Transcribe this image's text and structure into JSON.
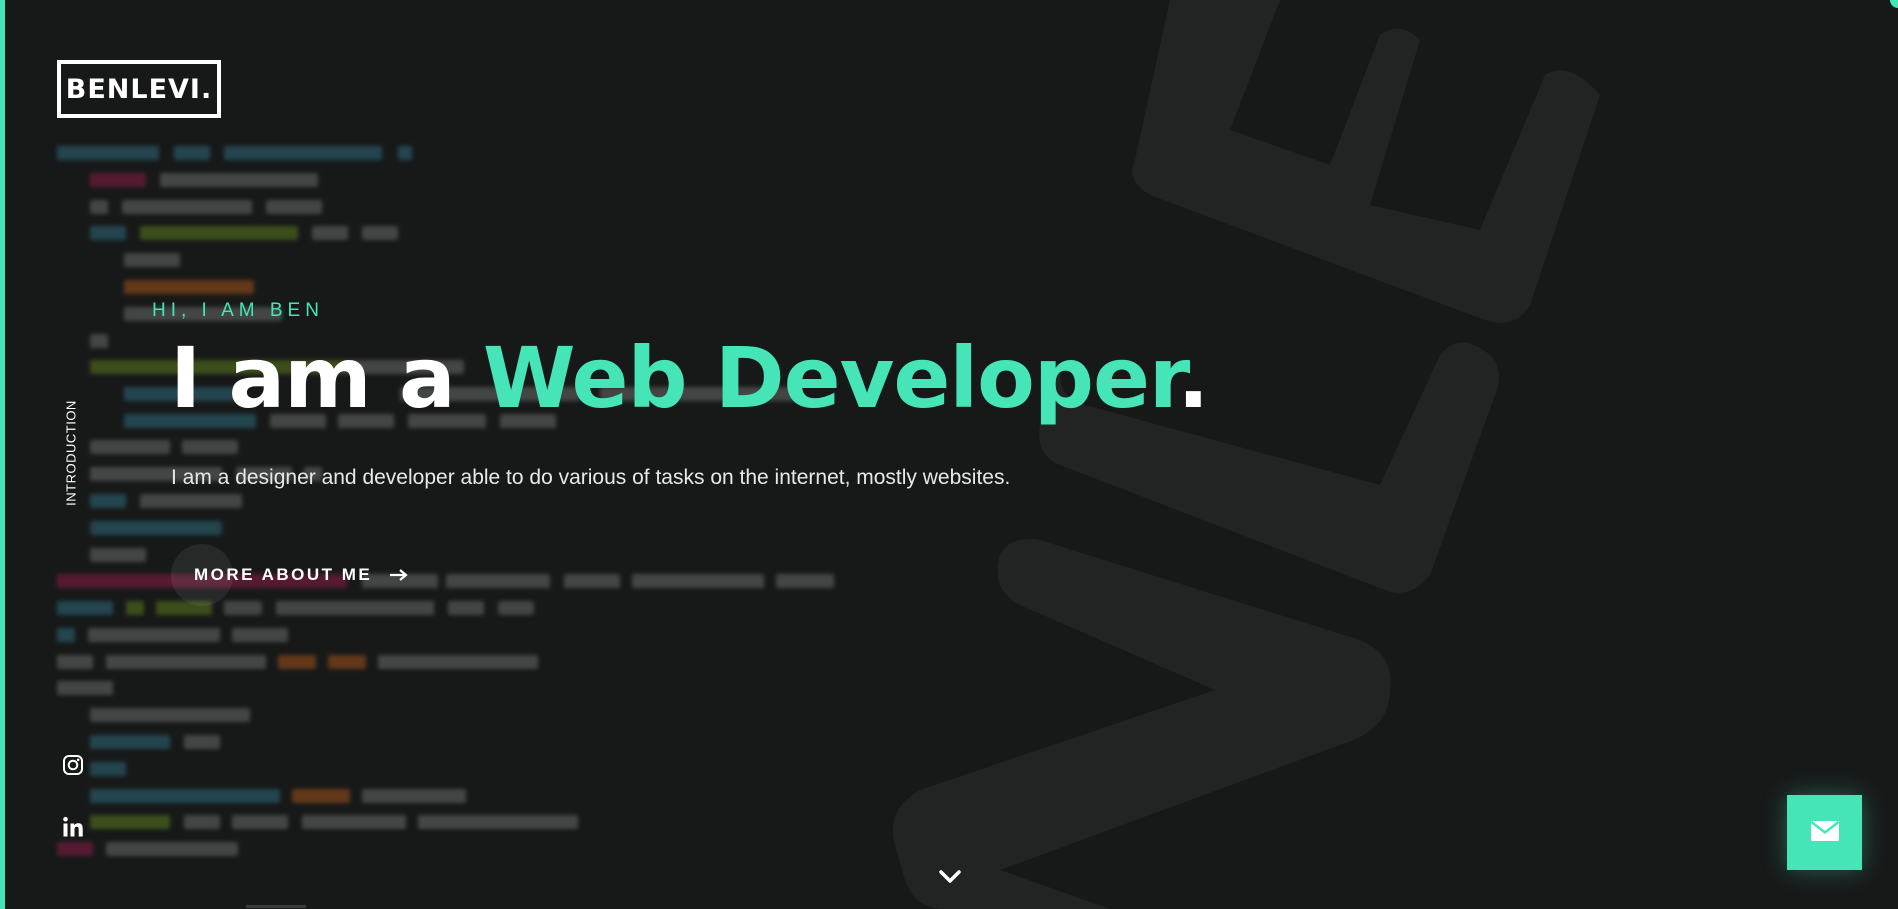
{
  "colors": {
    "background": "#171919",
    "accent": "#46e5b8",
    "text": "#ffffff"
  },
  "brand": {
    "logo_text": "BENLEVI."
  },
  "side_label": "INTRODUCTION",
  "hero": {
    "greeting": "HI, I AM BEN",
    "headline_prefix": "I am a ",
    "headline_accent": "Web Developer",
    "headline_suffix": ".",
    "subtitle": "I am a designer and developer able to do various of tasks on the internet, mostly websites.",
    "cta_label": "MORE ABOUT ME"
  },
  "icons": {
    "cta_arrow": "arrow-right-icon",
    "social_1": "instagram-icon",
    "social_2": "linkedin-icon",
    "scroll": "chevron-down-icon",
    "mail": "mail-icon"
  }
}
